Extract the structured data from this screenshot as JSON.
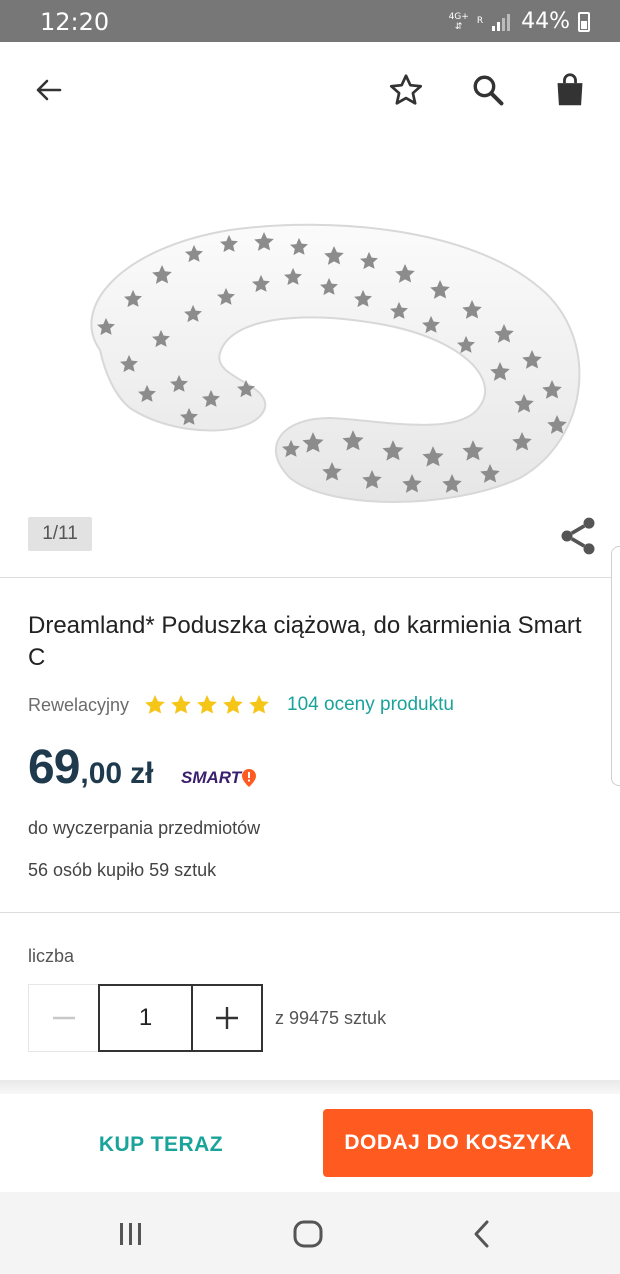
{
  "status_bar": {
    "time": "12:20",
    "network": "4G+",
    "roaming": "R",
    "battery": "44%"
  },
  "app_bar": {
    "back_icon": "arrow-left-icon",
    "favorite_icon": "star-outline-icon",
    "search_icon": "search-icon",
    "cart_icon": "shopping-bag-icon"
  },
  "gallery": {
    "counter": "1/11",
    "image": "pregnancy-pillow-star-pattern"
  },
  "product": {
    "title": "Dreamland* Poduszka ciążowa, do karmienia Smart C",
    "rating_word": "Rewelacyjny",
    "rating_stars": 5,
    "reviews": "104 oceny produktu",
    "price_main": "69",
    "price_rest": ",00",
    "currency": "zł",
    "smart_badge": "SMART",
    "availability": "do wyczerpania przedmiotów",
    "sold": "56 osób kupiło 59 sztuk"
  },
  "quantity": {
    "label": "liczba",
    "value": "1",
    "stock": "z 99475 sztuk"
  },
  "actions": {
    "buy_now": "KUP TERAZ",
    "add_to_cart": "DODAJ DO KOSZYKA"
  },
  "colors": {
    "accent": "#1aa39a",
    "cart_button": "#ff5a1f",
    "price": "#1f3a4d",
    "star": "#f5c518"
  }
}
